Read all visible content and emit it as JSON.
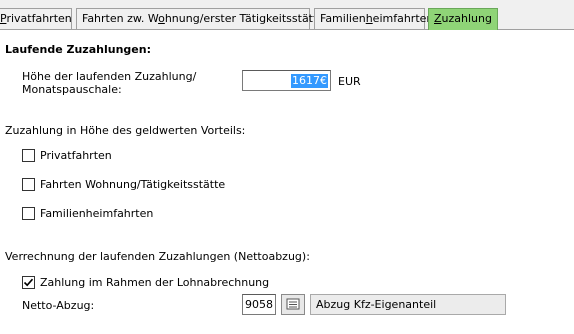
{
  "tabs": [
    {
      "pre": "",
      "u": "P",
      "post": "rivatfahrten",
      "active": false
    },
    {
      "pre": "Fahrten zw. W",
      "u": "o",
      "post": "hnung/erster Tätigkeitsstätte",
      "active": false
    },
    {
      "pre": "Familien",
      "u": "h",
      "post": "eimfahrten",
      "active": false
    },
    {
      "pre": "",
      "u": "Z",
      "post": "uzahlung",
      "active": true
    }
  ],
  "section_current": {
    "heading": "Laufende Zuzahlungen:",
    "amount_label_line1": "Höhe der laufenden Zuzahlung/",
    "amount_label_line2": "Monatspauschale:",
    "amount_value": "1617€",
    "currency": "EUR"
  },
  "section_benefit": {
    "heading": "Zuzahlung in Höhe des geldwerten Vorteils:",
    "options": [
      {
        "label": "Privatfahrten",
        "checked": false
      },
      {
        "label": "Fahrten Wohnung/Tätigkeitsstätte",
        "checked": false
      },
      {
        "label": "Familienheimfahrten",
        "checked": false
      }
    ]
  },
  "section_netting": {
    "heading": "Verrechnung der laufenden Zuzahlungen (Nettoabzug):",
    "payroll_label": "Zahlung im Rahmen der Lohnabrechnung",
    "payroll_checked": true,
    "netto_label": "Netto-Abzug:",
    "netto_code": "9058",
    "netto_description": "Abzug Kfz-Eigenanteil"
  },
  "icons": {
    "lookup": "lookup-list-icon",
    "check": "checkmark-icon"
  }
}
